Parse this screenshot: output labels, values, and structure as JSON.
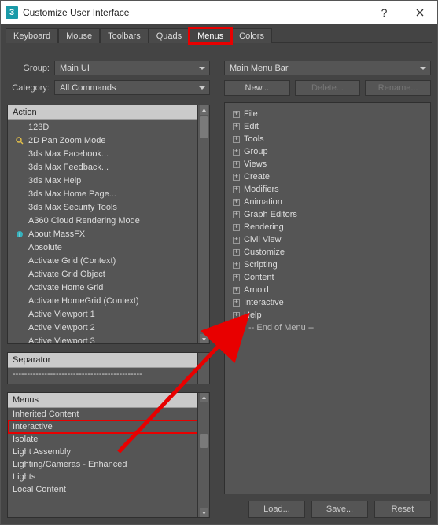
{
  "window": {
    "app_icon_text": "3",
    "title": "Customize User Interface",
    "help_glyph": "?",
    "close_glyph": "×"
  },
  "tabs": [
    "Keyboard",
    "Mouse",
    "Toolbars",
    "Quads",
    "Menus",
    "Colors"
  ],
  "left": {
    "group_label": "Group:",
    "group_value": "Main UI",
    "category_label": "Category:",
    "category_value": "All Commands",
    "action_header": "Action",
    "actions": [
      {
        "label": "123D",
        "icon": null
      },
      {
        "label": "2D Pan Zoom Mode",
        "icon": "pan-zoom"
      },
      {
        "label": "3ds Max Facebook...",
        "icon": null
      },
      {
        "label": "3ds Max Feedback...",
        "icon": null
      },
      {
        "label": "3ds Max Help",
        "icon": null
      },
      {
        "label": "3ds Max Home Page...",
        "icon": null
      },
      {
        "label": "3ds Max Security Tools",
        "icon": null
      },
      {
        "label": "A360 Cloud Rendering Mode",
        "icon": null
      },
      {
        "label": "About MassFX",
        "icon": "info"
      },
      {
        "label": "Absolute",
        "icon": null
      },
      {
        "label": "Activate Grid (Context)",
        "icon": null
      },
      {
        "label": "Activate Grid Object",
        "icon": null
      },
      {
        "label": "Activate Home Grid",
        "icon": null
      },
      {
        "label": "Activate HomeGrid (Context)",
        "icon": null
      },
      {
        "label": "Active Viewport 1",
        "icon": null
      },
      {
        "label": "Active Viewport 2",
        "icon": null
      },
      {
        "label": "Active Viewport 3",
        "icon": null
      }
    ],
    "separator_header": "Separator",
    "separator_text": "---------------------------------------------",
    "menus_header": "Menus",
    "menus": [
      "Inherited Content",
      "Interactive",
      "Isolate",
      "Light Assembly",
      "Lighting/Cameras - Enhanced",
      "Lights",
      "Local Content"
    ],
    "highlighted_menu_index": 1
  },
  "right": {
    "menu_bar_value": "Main Menu Bar",
    "new_btn": "New...",
    "delete_btn": "Delete...",
    "rename_btn": "Rename...",
    "tree": [
      "File",
      "Edit",
      "Tools",
      "Group",
      "Views",
      "Create",
      "Modifiers",
      "Animation",
      "Graph Editors",
      "Rendering",
      "Civil View",
      "Customize",
      "Scripting",
      "Content",
      "Arnold",
      "Interactive",
      "Help"
    ],
    "end_of_menu": "-- End of Menu --",
    "load_btn": "Load...",
    "save_btn": "Save...",
    "reset_btn": "Reset"
  }
}
